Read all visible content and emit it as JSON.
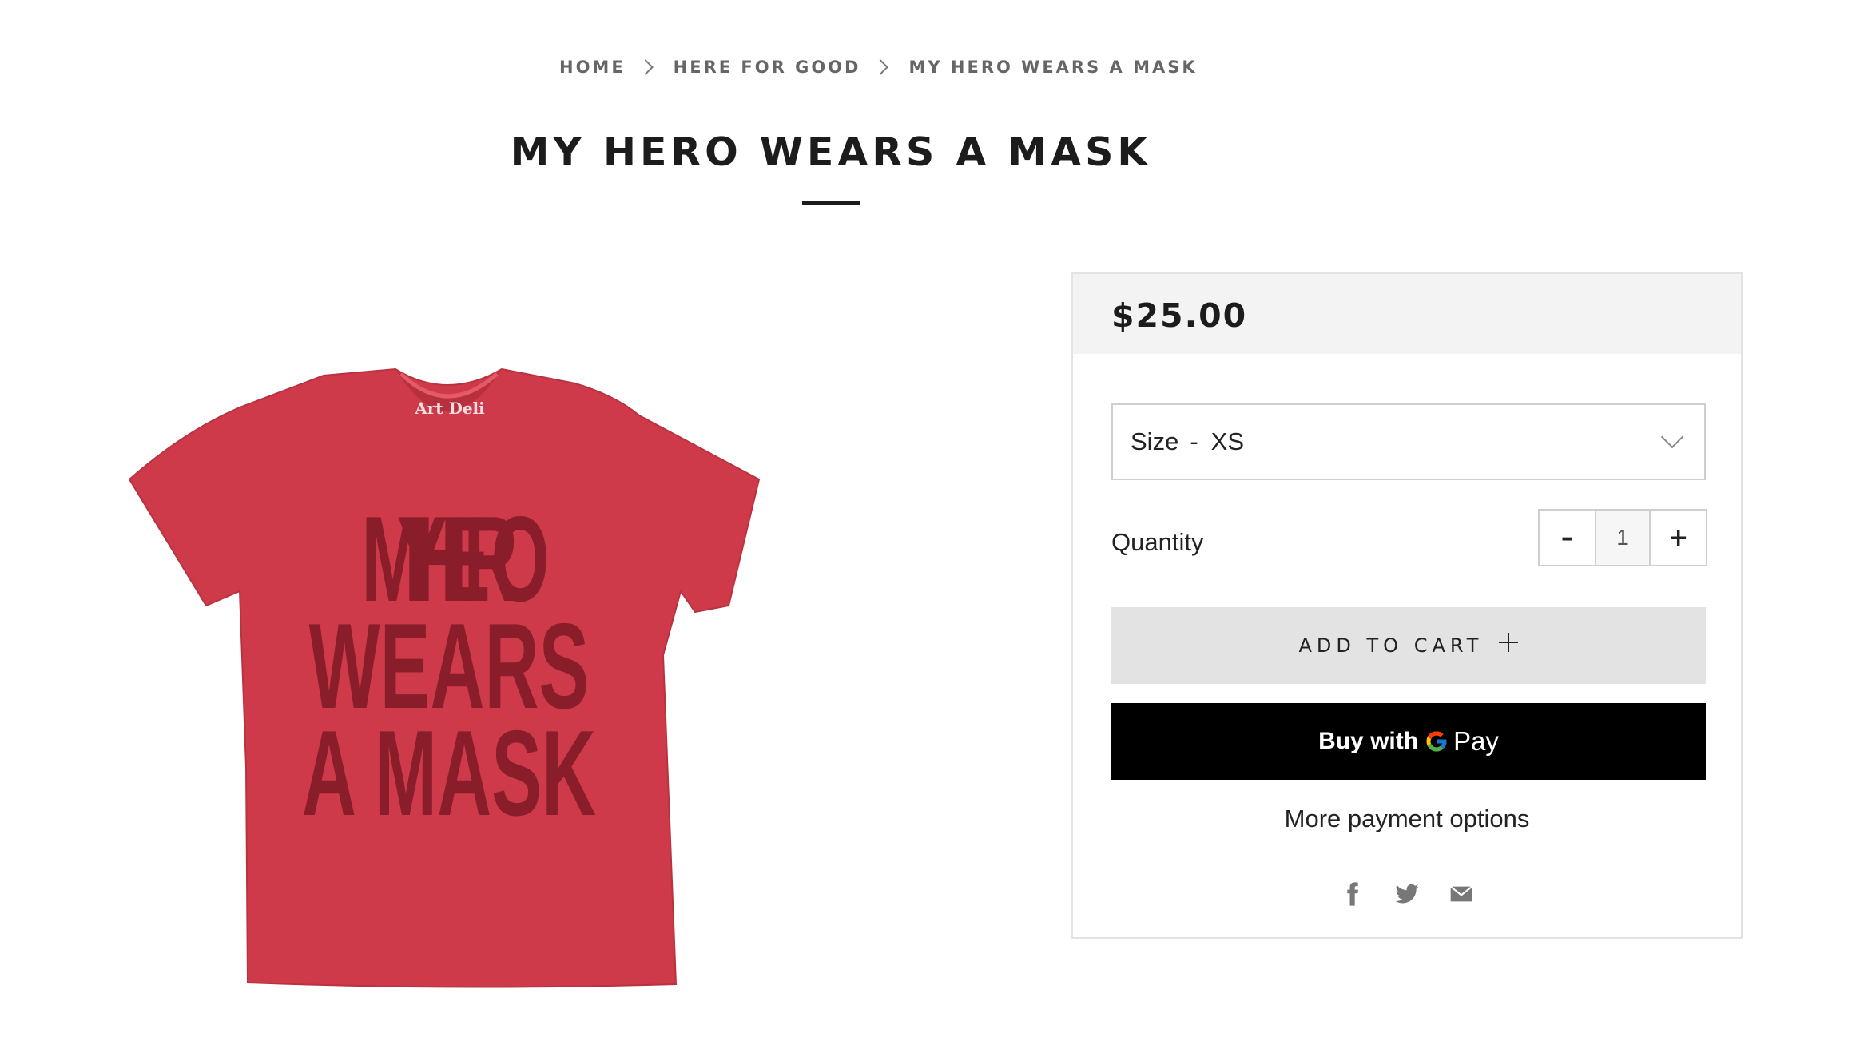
{
  "breadcrumb": {
    "items": [
      "HOME",
      "HERE FOR GOOD",
      "MY HERO WEARS A MASK"
    ]
  },
  "page_title": "MY HERO WEARS A MASK",
  "product_image": {
    "shirt_text_lines": [
      "MY HERO",
      "WEARS",
      "A MASK"
    ],
    "collar_logo_text": "Art Deli",
    "color": "#cf3a4a"
  },
  "panel": {
    "price": "$25.00",
    "size_select": {
      "label": "Size",
      "separator": "-",
      "value": "XS"
    },
    "quantity": {
      "label": "Quantity",
      "decrement": "–",
      "value": "1",
      "increment": "+"
    },
    "add_to_cart_label": "ADD TO CART",
    "gpay": {
      "buy_with": "Buy with",
      "pay": "Pay"
    },
    "more_payment_options": "More payment options",
    "share_icons": [
      "facebook-icon",
      "twitter-icon",
      "email-icon"
    ]
  },
  "colors": {
    "price_bar_bg": "#f3f3f3",
    "add_to_cart_bg": "#e3e3e3",
    "gpay_bg": "#000000"
  }
}
